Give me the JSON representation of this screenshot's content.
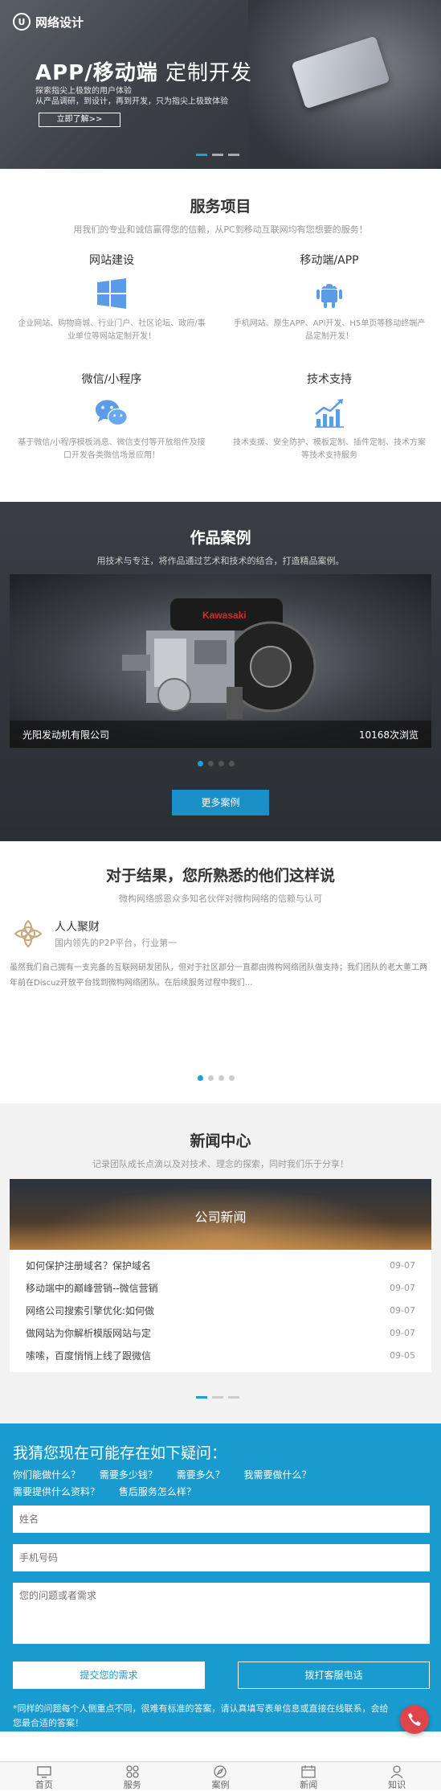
{
  "hero": {
    "logo_mark": "U",
    "logo_text": "网络设计",
    "title_bold": "APP/移动端",
    "title_rest": "定制开发",
    "sub_line1": "探索指尖上极致的用户体验",
    "sub_line2": "从产品调研，到设计，再到开发，只为指尖上极致体验",
    "button": "立即了解>>"
  },
  "services": {
    "title": "服务项目",
    "subtitle": "用我们的专业和诚信赢得您的信赖，从PC到移动互联网均有您想要的服务！",
    "items": [
      {
        "title": "网站建设",
        "desc": "企业网站、购物商城、行业门户、社区论坛、政府/事业单位等网站定制开发！",
        "icon": "windows-icon"
      },
      {
        "title": "移动端/APP",
        "desc": "手机网站、原生APP、API开发、H5单页等移动终端产品定制开发！",
        "icon": "android-icon"
      },
      {
        "title": "微信/小程序",
        "desc": "基于微信/小程序模板消息、微信支付等开放组件及接口开发各类微信场景应用！",
        "icon": "wechat-icon"
      },
      {
        "title": "技术支持",
        "desc": "技术支援、安全防护、模板定制、插件定制、技术方案等技术支持服务",
        "icon": "chart-growth-icon"
      }
    ]
  },
  "cases": {
    "title": "作品案例",
    "subtitle": "用技术与专注，将作品通过艺术和技术的结合，打造精品案例。",
    "company": "光阳发动机有限公司",
    "views": "10168次浏览",
    "engine_brand": "Kawasaki",
    "more_button": "更多案例"
  },
  "testimonial": {
    "title": "对于结果，您所熟悉的他们这样说",
    "subtitle": "微构网络感恩众多知名伙伴对微构网络的信赖与认可",
    "name": "人人聚财",
    "desc": "国内领先的P2P平台，行业第一",
    "text": "虽然我们自己拥有一支完备的互联网研发团队，但对于社区部分一直都由微构网络团队做支持；我们团队的老大董工两年前在Discuz开放平台找到微构网络团队。在后续服务过程中我们..."
  },
  "news": {
    "title": "新闻中心",
    "subtitle": "记录团队成长点滴以及对技术、理念的探索，同时我们乐于分享！",
    "banner": "公司新闻",
    "items": [
      {
        "title": "如何保护注册域名？保护域名",
        "date": "09-07"
      },
      {
        "title": "移动端中的巅峰营销--微信营销",
        "date": "09-07"
      },
      {
        "title": "网络公司搜索引擎优化:如何做",
        "date": "09-07"
      },
      {
        "title": "做网站为你解析模版网站与定",
        "date": "09-07"
      },
      {
        "title": "嗦嗦，百度悄悄上线了跟微信",
        "date": "09-05"
      }
    ]
  },
  "faq": {
    "title": "我猜您现在可能存在如下疑问：",
    "questions": [
      "你们能做什么？",
      "需要多少钱？",
      "需要多久？",
      "我需要做什么？",
      "需要提供什么资料？",
      "售后服务怎么样？"
    ],
    "name_placeholder": "姓名",
    "phone_placeholder": "手机号码",
    "question_placeholder": "您的问题或者需求",
    "submit": "提交您的需求",
    "call": "拨打客服电话",
    "note": "*同样的问题每个人侧重点不同，很难有标准的答案，请认真填写表单信息或直接在线联系，会给您最合适的答案！"
  },
  "footer": {
    "items": [
      {
        "label": "首页",
        "icon": "home-icon"
      },
      {
        "label": "服务",
        "icon": "services-icon"
      },
      {
        "label": "案例",
        "icon": "compass-icon"
      },
      {
        "label": "新闻",
        "icon": "news-icon"
      },
      {
        "label": "知识",
        "icon": "person-icon"
      }
    ]
  },
  "colors": {
    "accent": "#1a9bd0",
    "icon_blue": "#5b9be8"
  }
}
